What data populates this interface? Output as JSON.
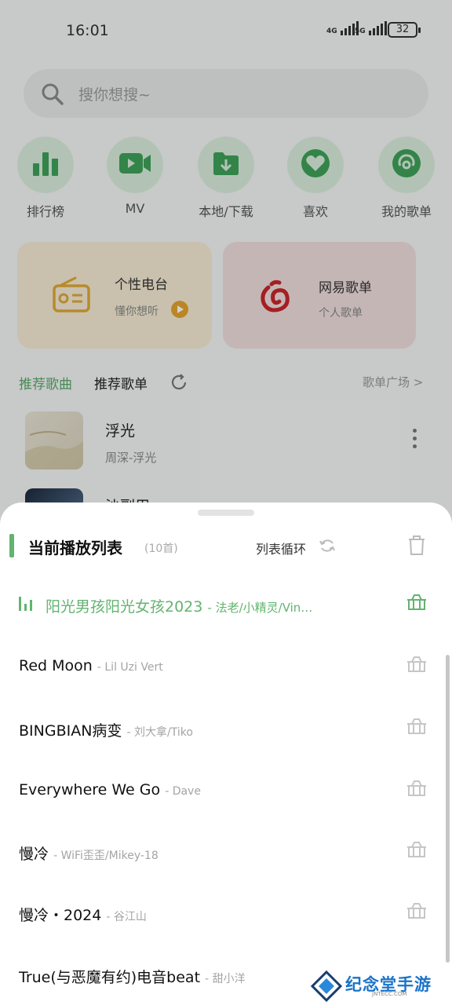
{
  "status_bar": {
    "time": "16:01",
    "net1": "4G",
    "net2": "5G",
    "battery": "32"
  },
  "search": {
    "placeholder": "搜你想搜~"
  },
  "quick_actions": [
    {
      "label": "排行榜",
      "icon": "bar-chart-icon"
    },
    {
      "label": "MV",
      "icon": "video-camera-icon"
    },
    {
      "label": "本地/下载",
      "icon": "download-folder-icon"
    },
    {
      "label": "喜欢",
      "icon": "heart-icon"
    },
    {
      "label": "我的歌单",
      "icon": "disc-icon"
    }
  ],
  "cards": [
    {
      "title": "个性电台",
      "subtitle": "懂你想听",
      "icon": "radio-icon"
    },
    {
      "title": "网易歌单",
      "subtitle": "个人歌单",
      "icon": "netease-icon"
    }
  ],
  "tabs": {
    "recommended_songs": "推荐歌曲",
    "recommended_playlists": "推荐歌单",
    "square": "歌单广场 >"
  },
  "background_songs": [
    {
      "title": "浮光",
      "subtitle": "周深-浮光"
    },
    {
      "title": "沙副用"
    }
  ],
  "playlist_sheet": {
    "title": "当前播放列表",
    "count": "(10首)",
    "mode": "列表循环",
    "tracks": [
      {
        "title": "阳光男孩阳光女孩2023",
        "artist": "- 法老/小精灵/Vin…",
        "playing": true
      },
      {
        "title": "Red Moon",
        "artist": "- Lil Uzi Vert"
      },
      {
        "title": "BINGBIAN病变",
        "artist": "- 刘大拿/Tiko"
      },
      {
        "title": "Everywhere We Go",
        "artist": "- Dave"
      },
      {
        "title": "慢冷",
        "artist": "- WiFi歪歪/Mikey-18"
      },
      {
        "title": "慢冷・2024",
        "artist": "- 谷江山"
      },
      {
        "title": "True(与恶魔有约)电音beat",
        "artist": "- 甜小洋"
      }
    ]
  },
  "watermark": {
    "text": "纪念堂手游",
    "sub": "JNTECC.COM"
  },
  "colors": {
    "accent": "#62b46f",
    "icon_bg": "#d9eedd",
    "card_radio": "#f6ecd3",
    "card_netease": "#f1dede"
  }
}
